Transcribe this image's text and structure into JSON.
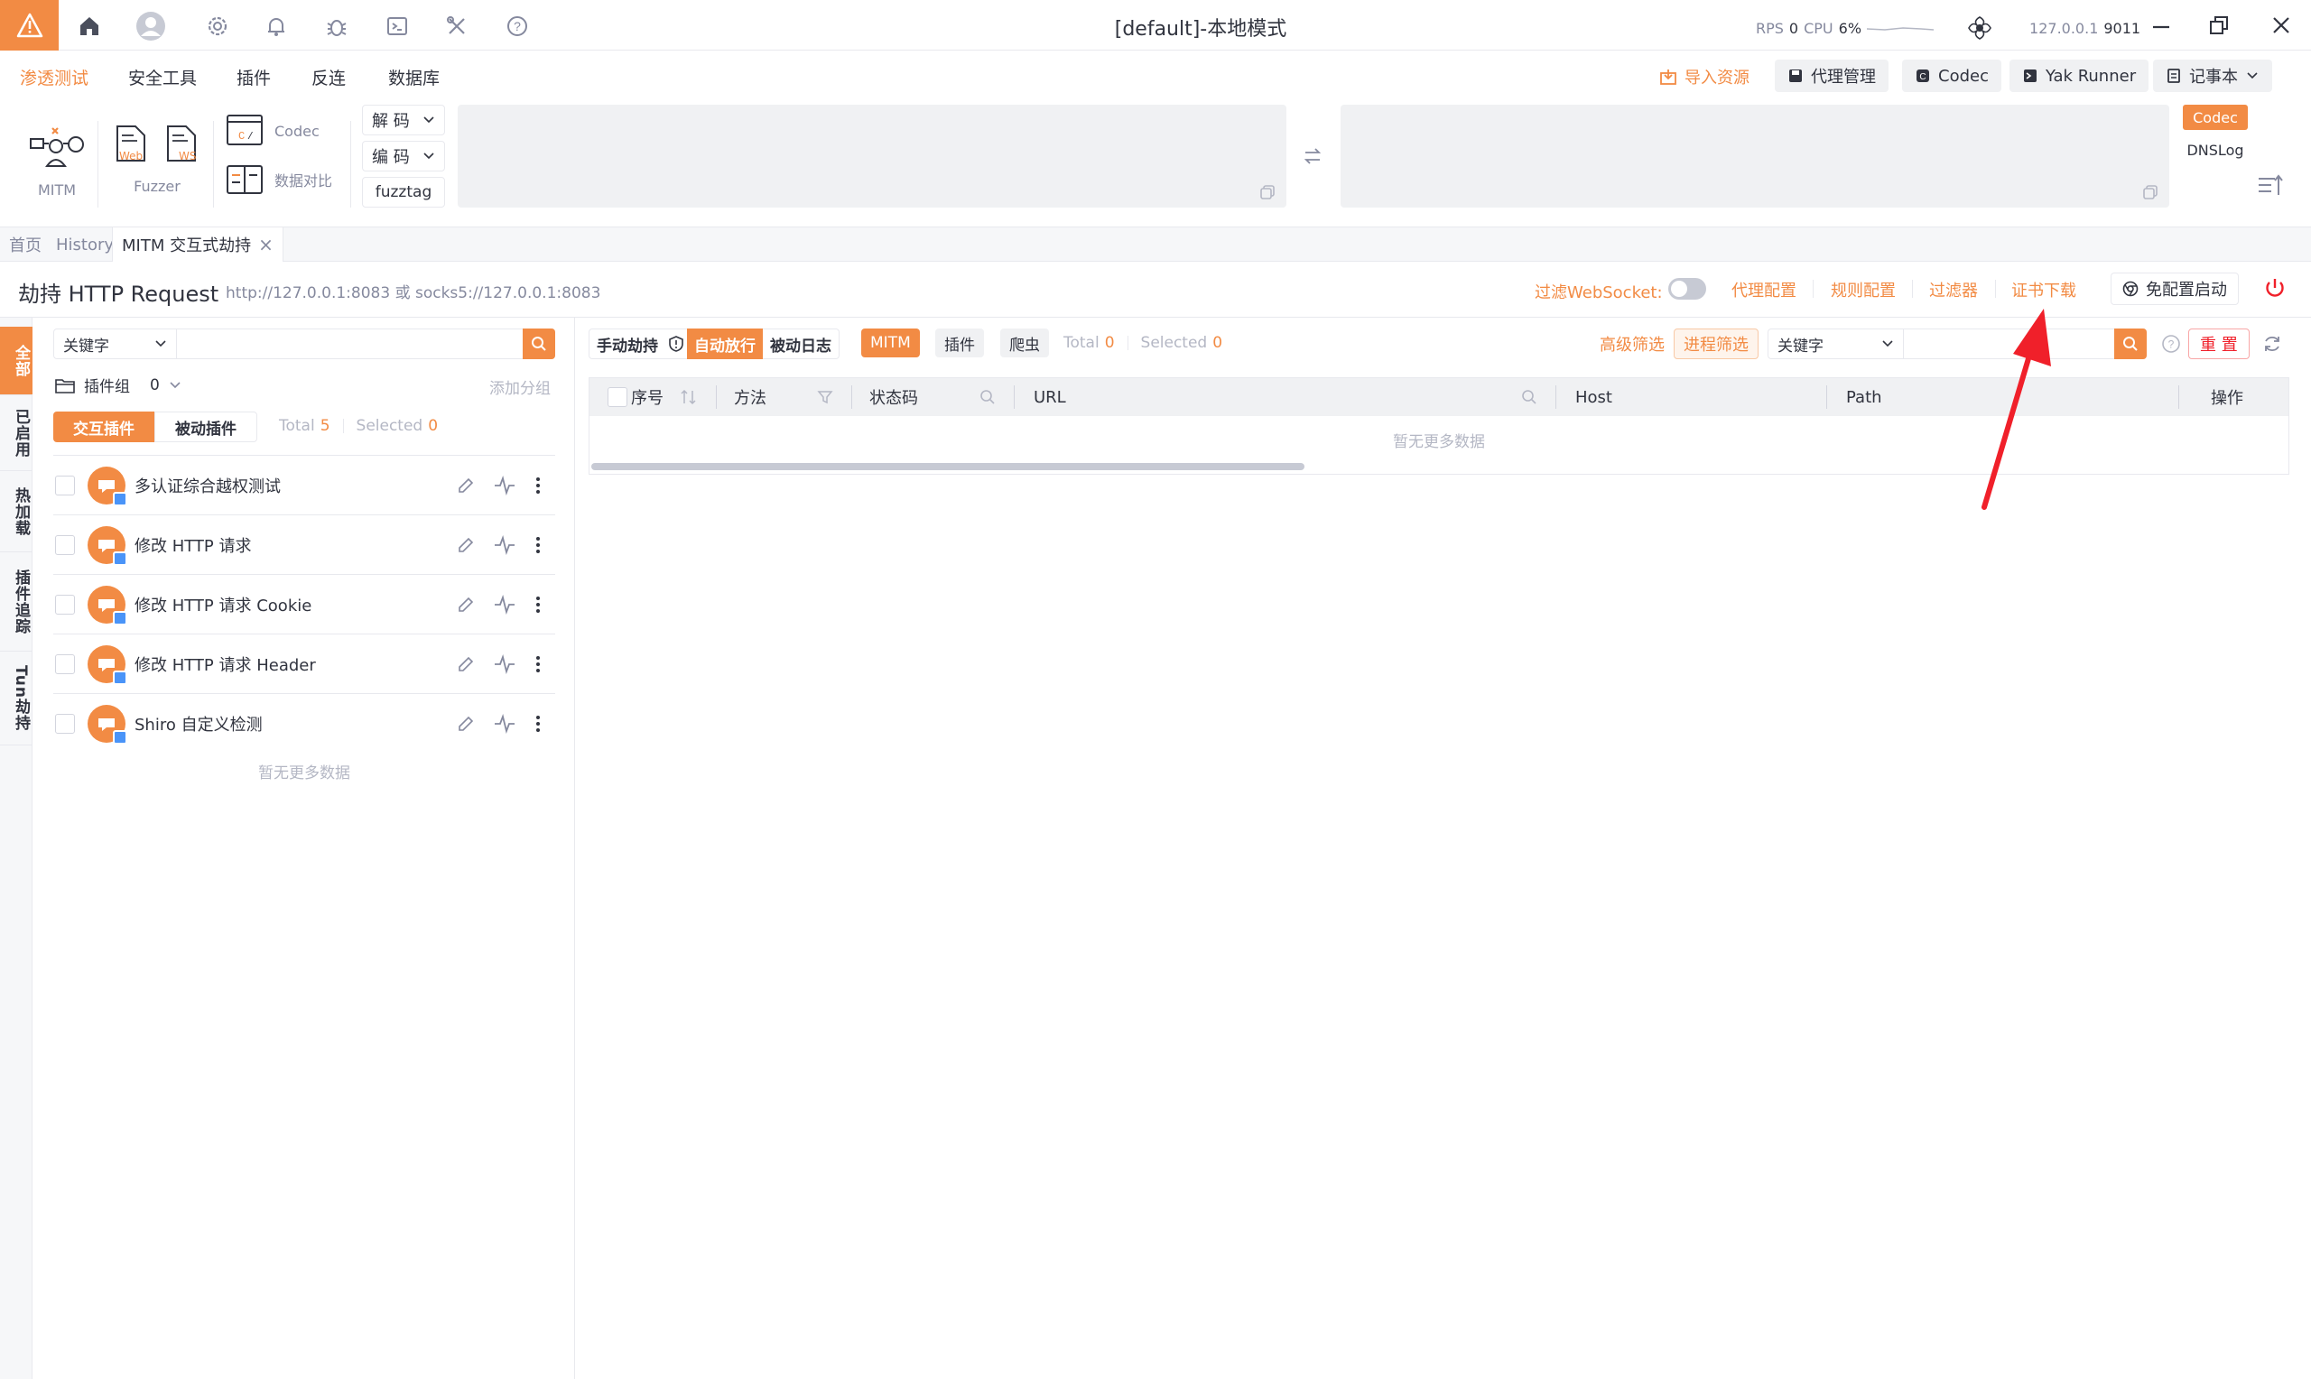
{
  "titlebar": {
    "title": "[default]-本地模式",
    "rps_label": "RPS",
    "rps_value": "0",
    "cpu_label": "CPU",
    "cpu_value": "6%",
    "engine_host": "127.0.0.1",
    "engine_port": "9011"
  },
  "menu": {
    "items": [
      "渗透测试",
      "安全工具",
      "插件",
      "反连",
      "数据库"
    ],
    "import_label": "导入资源",
    "proxy_label": "代理管理",
    "codec_label": "Codec",
    "yakrunner_label": "Yak Runner",
    "notebook_label": "记事本"
  },
  "toolbar": {
    "mitm_label": "MITM",
    "web_label": "Web",
    "ws_label": "WS",
    "fuzzer_label": "Fuzzer",
    "codec_label": "Codec",
    "compare_label": "数据对比",
    "decode_label": "解 码",
    "encode_label": "编 码",
    "fuzztag_label": "fuzztag",
    "side_codec": "Codec",
    "side_dnslog": "DNSLog"
  },
  "tabs": {
    "home": "首页",
    "history": "History",
    "mitm": "MITM 交互式劫持",
    "close": "×"
  },
  "header": {
    "title": "劫持 HTTP Request",
    "address": "http://127.0.0.1:8083 或 socks5://127.0.0.1:8083",
    "filter_ws": "过滤WebSocket:",
    "proxy_config": "代理配置",
    "rule_config": "规则配置",
    "filter": "过滤器",
    "cert_download": "证书下载",
    "no_config_start": "免配置启动"
  },
  "vnav": [
    "全部",
    "已启用",
    "热加载",
    "插件追踪",
    "Tun劫持"
  ],
  "plugins": {
    "search_select": "关键字",
    "group_label": "插件组",
    "group_count": "0",
    "add_group": "添加分组",
    "tab_interactive": "交互插件",
    "tab_passive": "被动插件",
    "total_label": "Total",
    "total_value": "5",
    "selected_label": "Selected",
    "selected_value": "0",
    "items": [
      "多认证综合越权测试",
      "修改 HTTP 请求",
      "修改 HTTP 请求 Cookie",
      "修改 HTTP 请求 Header",
      "Shiro 自定义检测"
    ],
    "no_more": "暂无更多数据"
  },
  "traffic": {
    "manual": "手动劫持",
    "auto": "自动放行",
    "passive_log": "被动日志",
    "mitm": "MITM",
    "plugin": "插件",
    "crawler": "爬虫",
    "total_label": "Total",
    "total_value": "0",
    "selected_label": "Selected",
    "selected_value": "0",
    "advanced_filter": "高级筛选",
    "process_filter": "进程筛选",
    "keyword_select": "关键字",
    "reset": "重 置",
    "columns": [
      "序号",
      "方法",
      "状态码",
      "URL",
      "Host",
      "Path",
      "操作"
    ],
    "empty": "暂无更多数据"
  },
  "colors": {
    "accent": "#f28b44",
    "annotation_arrow": "#f0202a"
  }
}
